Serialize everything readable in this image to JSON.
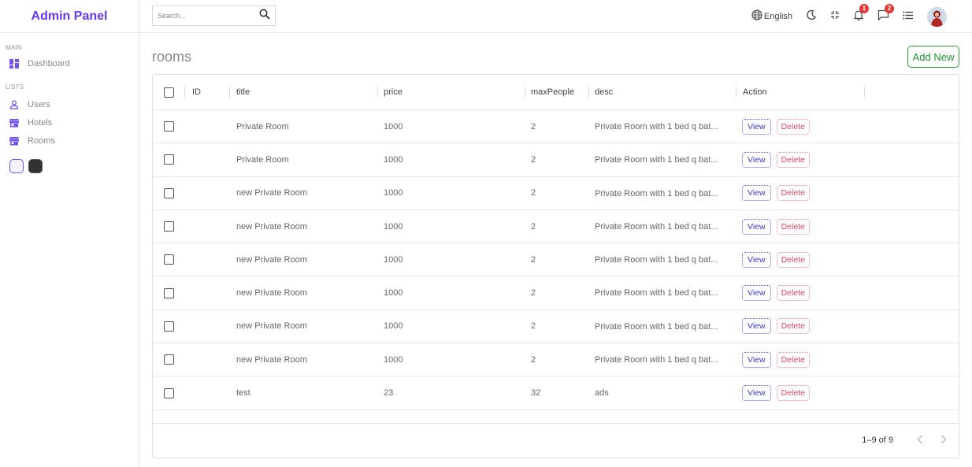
{
  "sidebar": {
    "logo": "Admin Panel",
    "sections": [
      {
        "title": "MAIN",
        "items": [
          {
            "label": "Dashboard",
            "icon": "dashboard-icon"
          }
        ]
      },
      {
        "title": "LISTS",
        "items": [
          {
            "label": "Users",
            "icon": "user-icon"
          },
          {
            "label": "Hotels",
            "icon": "store-icon"
          },
          {
            "label": "Rooms",
            "icon": "store-icon"
          }
        ]
      }
    ]
  },
  "navbar": {
    "search_placeholder": "Search...",
    "language": "English",
    "notifications_count": "1",
    "messages_count": "2"
  },
  "page": {
    "title": "rooms",
    "add_button": "Add New"
  },
  "grid": {
    "columns": [
      "ID",
      "title",
      "price",
      "maxPeople",
      "desc",
      "Action"
    ],
    "rows": [
      {
        "title": "Private Room",
        "price": "1000",
        "maxPeople": "2",
        "desc": "Private Room with 1 bed q bat..."
      },
      {
        "title": "Private Room",
        "price": "1000",
        "maxPeople": "2",
        "desc": "Private Room with 1 bed q bat..."
      },
      {
        "title": "new Private Room",
        "price": "1000",
        "maxPeople": "2",
        "desc": "Private Room with 1 bed q bat..."
      },
      {
        "title": "new Private Room",
        "price": "1000",
        "maxPeople": "2",
        "desc": "Private Room with 1 bed q bat..."
      },
      {
        "title": "new Private Room",
        "price": "1000",
        "maxPeople": "2",
        "desc": "Private Room with 1 bed q bat..."
      },
      {
        "title": "new Private Room",
        "price": "1000",
        "maxPeople": "2",
        "desc": "Private Room with 1 bed q bat..."
      },
      {
        "title": "new Private Room",
        "price": "1000",
        "maxPeople": "2",
        "desc": "Private Room with 1 bed q bat..."
      },
      {
        "title": "new Private Room",
        "price": "1000",
        "maxPeople": "2",
        "desc": "Private Room with 1 bed q bat..."
      },
      {
        "title": "test",
        "price": "23",
        "maxPeople": "32",
        "desc": "ads"
      }
    ],
    "view_label": "View",
    "delete_label": "Delete",
    "pagination": "1–9 of 9"
  },
  "colors": {
    "accent": "#6439ff",
    "add_new": "#1f8f31",
    "view": "#3b3bbf",
    "delete": "#d94a66",
    "badge": "#e53935"
  }
}
